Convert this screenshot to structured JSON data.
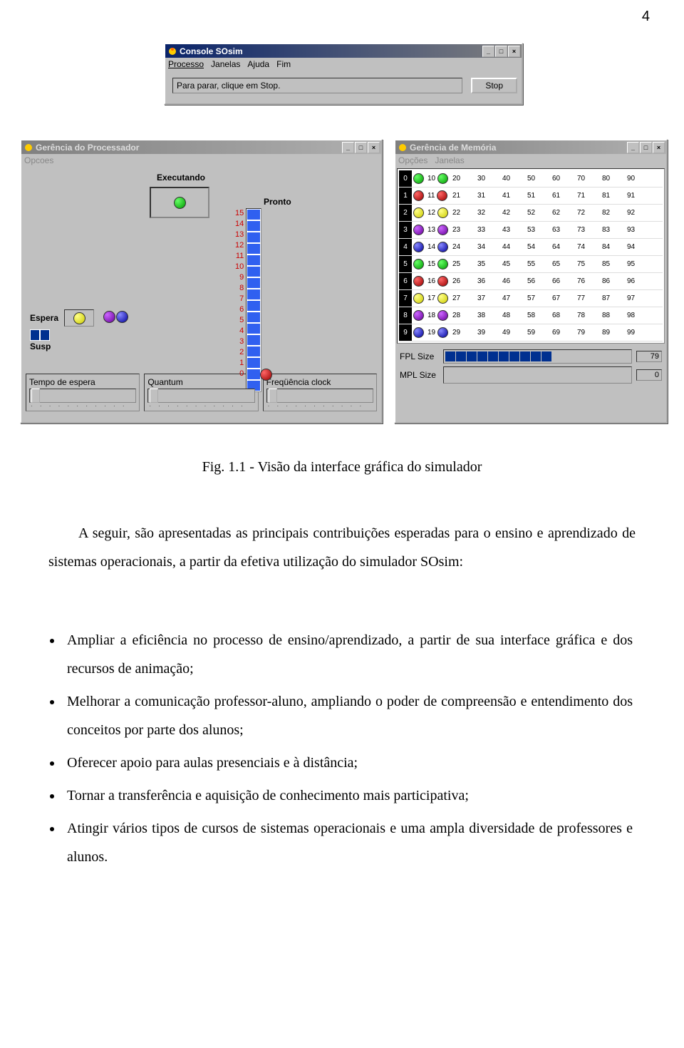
{
  "page_number": "4",
  "console": {
    "title": "Console SOsim",
    "menu": [
      "Processo",
      "Janelas",
      "Ajuda",
      "Fim"
    ],
    "status": "Para parar, clique em Stop.",
    "stop_btn": "Stop"
  },
  "proc": {
    "title": "Gerência do Processador",
    "menu": [
      "Opcoes"
    ],
    "executando": "Executando",
    "pronto": "Pronto",
    "pronto_nums": [
      "15",
      "14",
      "13",
      "12",
      "11",
      "10",
      "9",
      "8",
      "7",
      "6",
      "5",
      "4",
      "3",
      "2",
      "1",
      "0"
    ],
    "espera": "Espera",
    "susp": "Susp",
    "slider1": "Tempo de espera",
    "slider2": "Quantum",
    "slider3": "Freqüência clock"
  },
  "mem": {
    "title": "Gerência de Memória",
    "menu": [
      "Opções",
      "Janelas"
    ],
    "rows": [
      {
        "l": "0",
        "cells": [
          "10",
          "20",
          "30",
          "40",
          "50",
          "60",
          "70",
          "80",
          "90"
        ],
        "dots": {
          "0": "green",
          "1": "green"
        }
      },
      {
        "l": "1",
        "cells": [
          "11",
          "21",
          "31",
          "41",
          "51",
          "61",
          "71",
          "81",
          "91"
        ],
        "dots": {
          "0": "red",
          "1": "red"
        }
      },
      {
        "l": "2",
        "cells": [
          "12",
          "22",
          "32",
          "42",
          "52",
          "62",
          "72",
          "82",
          "92"
        ],
        "dots": {
          "0": "yellow",
          "1": "yellow"
        }
      },
      {
        "l": "3",
        "cells": [
          "13",
          "23",
          "33",
          "43",
          "53",
          "63",
          "73",
          "83",
          "93"
        ],
        "dots": {
          "0": "purple",
          "1": "purple"
        }
      },
      {
        "l": "4",
        "cells": [
          "14",
          "24",
          "34",
          "44",
          "54",
          "64",
          "74",
          "84",
          "94"
        ],
        "dots": {
          "0": "blue",
          "1": "blue"
        }
      },
      {
        "l": "5",
        "cells": [
          "15",
          "25",
          "35",
          "45",
          "55",
          "65",
          "75",
          "85",
          "95"
        ],
        "dots": {
          "0": "green",
          "1": "green"
        }
      },
      {
        "l": "6",
        "cells": [
          "16",
          "26",
          "36",
          "46",
          "56",
          "66",
          "76",
          "86",
          "96"
        ],
        "dots": {
          "0": "red",
          "1": "red"
        }
      },
      {
        "l": "7",
        "cells": [
          "17",
          "27",
          "37",
          "47",
          "57",
          "67",
          "77",
          "87",
          "97"
        ],
        "dots": {
          "0": "yellow",
          "1": "yellow"
        }
      },
      {
        "l": "8",
        "cells": [
          "18",
          "28",
          "38",
          "48",
          "58",
          "68",
          "78",
          "88",
          "98"
        ],
        "dots": {
          "0": "purple",
          "1": "purple"
        }
      },
      {
        "l": "9",
        "cells": [
          "19",
          "29",
          "39",
          "49",
          "59",
          "69",
          "79",
          "89",
          "99"
        ],
        "dots": {
          "0": "blue",
          "1": "blue"
        }
      }
    ],
    "fpl_label": "FPL Size",
    "fpl_val": "79",
    "mpl_label": "MPL Size",
    "mpl_val": "0"
  },
  "caption": "Fig. 1.1 - Visão da interface gráfica do simulador",
  "para": "A seguir, são apresentadas as principais contribuições esperadas para o ensino e aprendizado de sistemas operacionais, a partir da efetiva utilização do simulador SOsim:",
  "bullets": [
    "Ampliar a eficiência no processo de ensino/aprendizado, a partir de sua interface gráfica e dos recursos de animação;",
    "Melhorar a comunicação professor-aluno, ampliando o poder de compreensão e entendimento dos conceitos por parte dos alunos;",
    "Oferecer apoio para aulas presenciais e à distância;",
    "Tornar a transferência e aquisição de conhecimento mais participativa;",
    "Atingir vários tipos de cursos de sistemas operacionais e uma ampla diversidade de professores e alunos."
  ]
}
